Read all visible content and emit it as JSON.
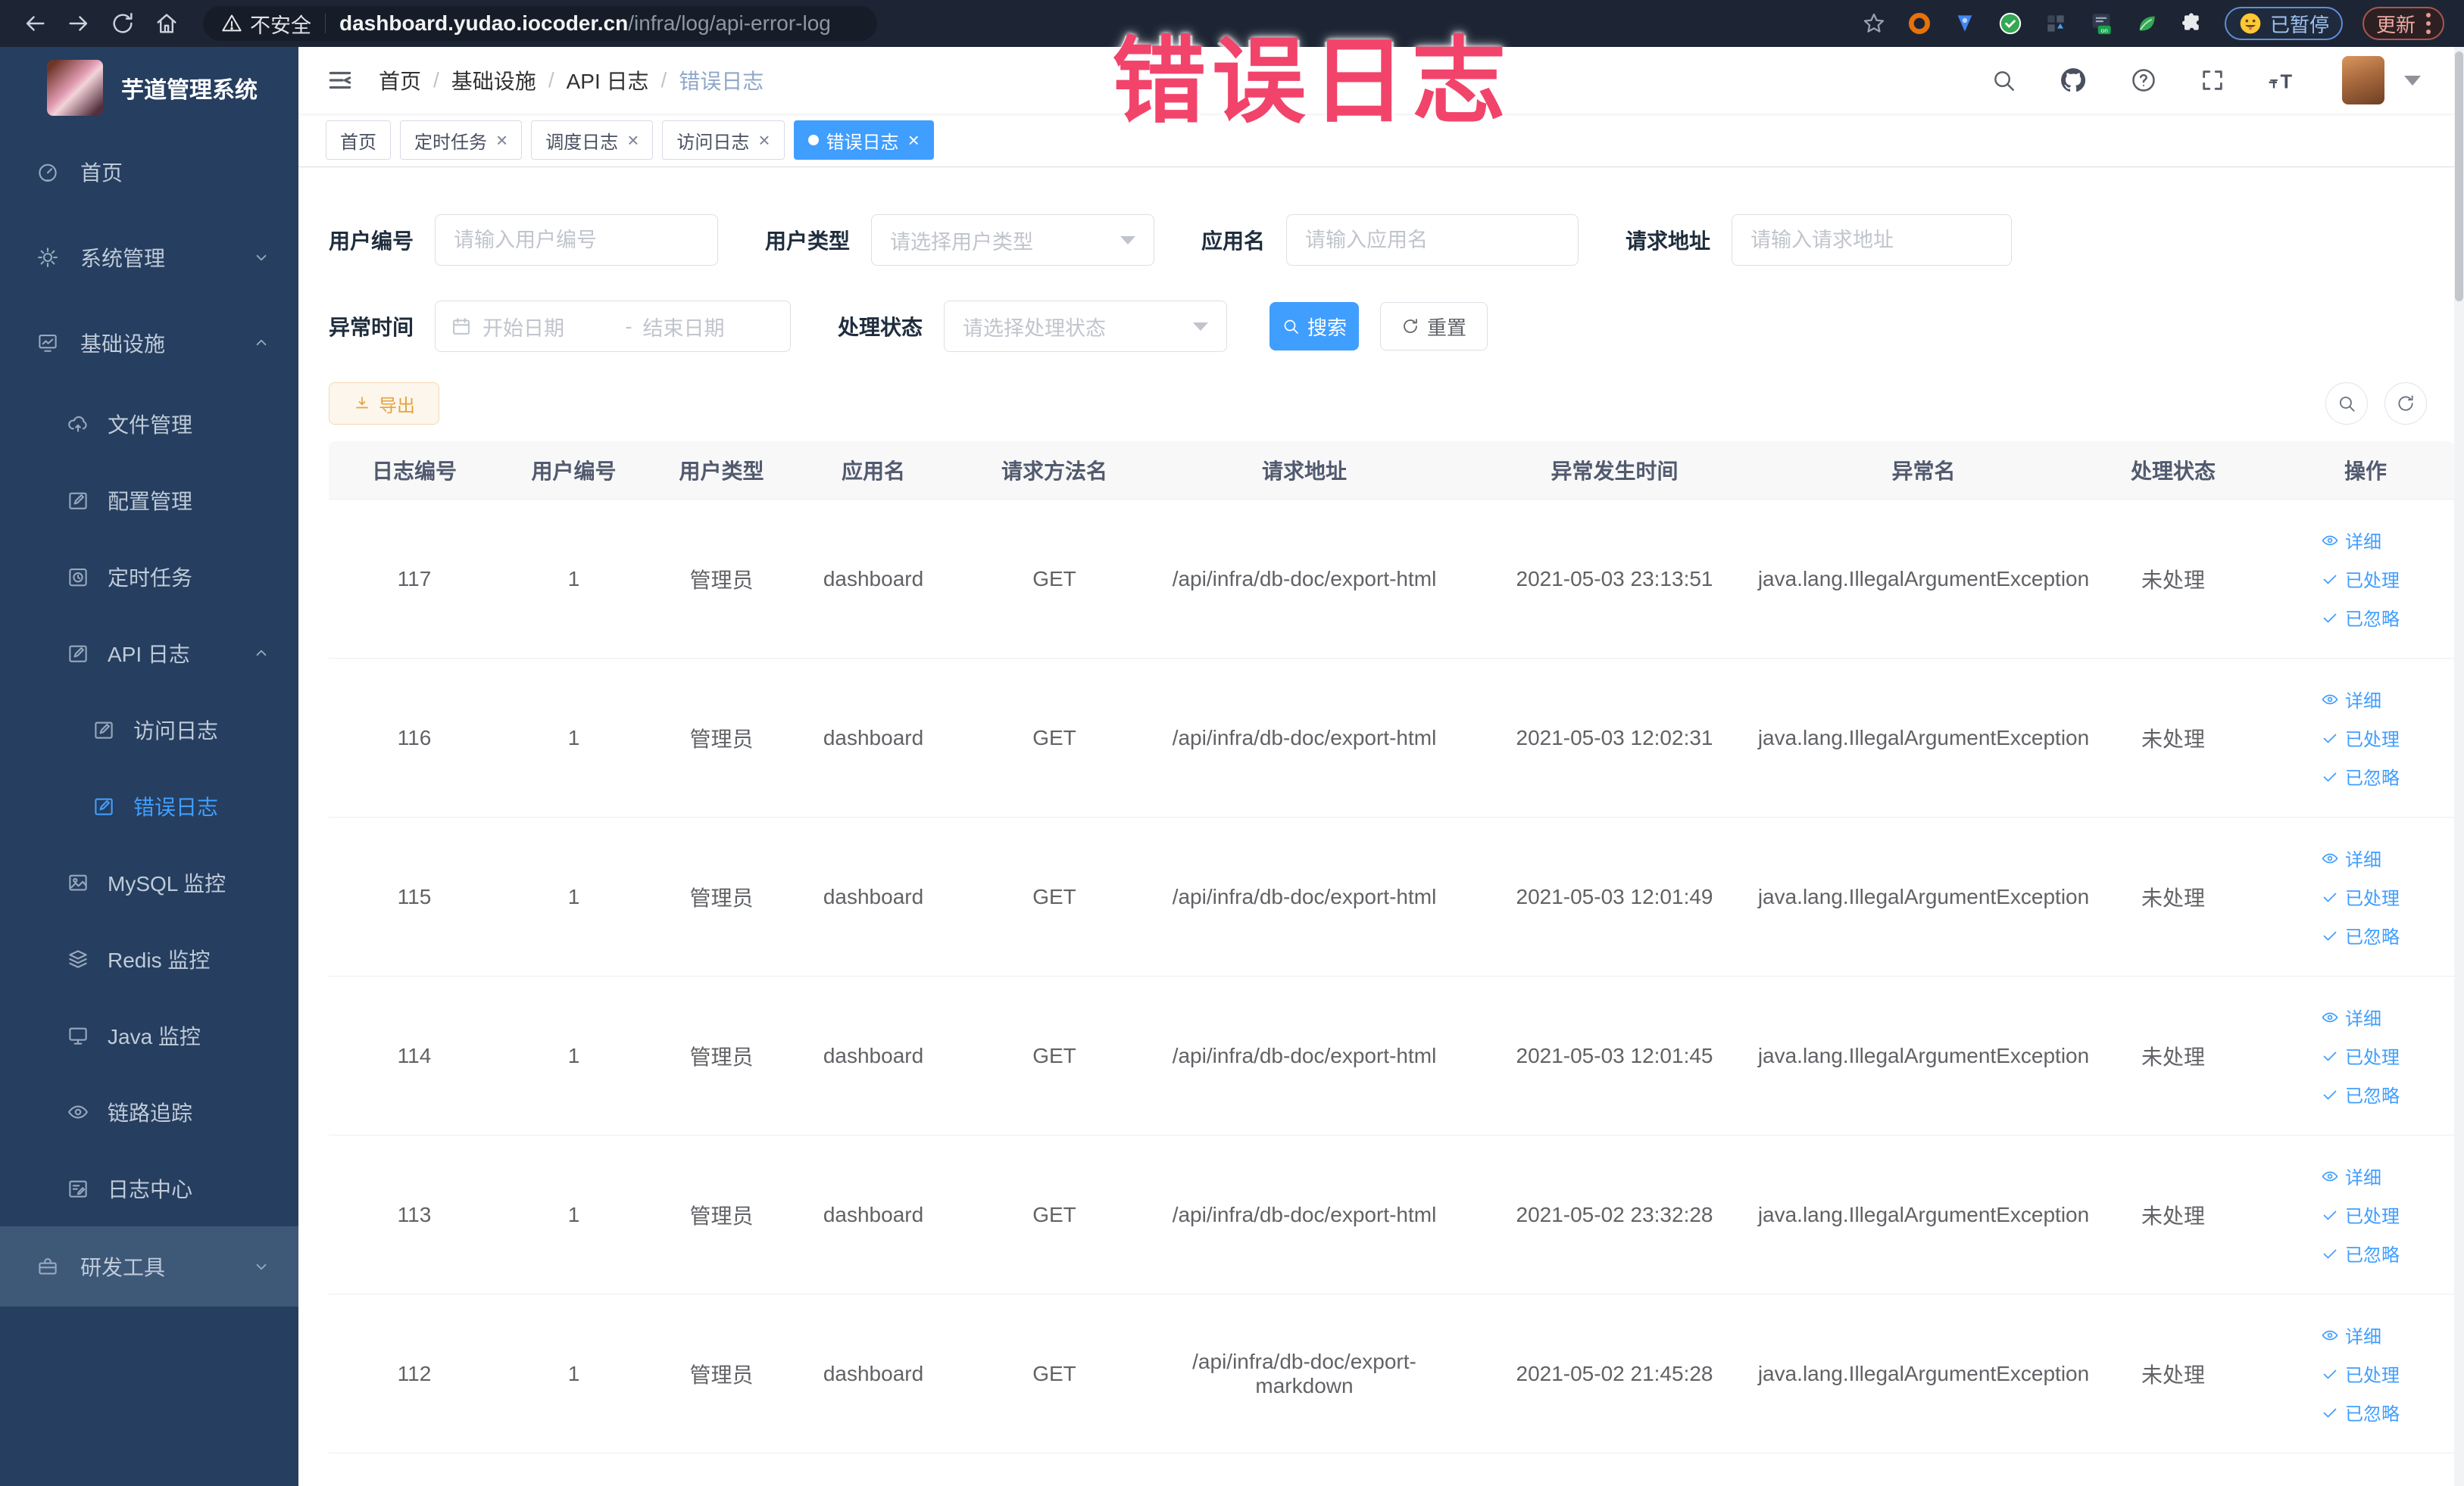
{
  "theme": {
    "accent": "#409eff",
    "sidebar_bg": "#263e5f",
    "browser_bg": "#1d2534",
    "annotation_color": "#f2436b",
    "export_warning": "#e6a23c",
    "table_header_bg": "#f8f8f9"
  },
  "annotation": {
    "text": "错误日志"
  },
  "browser": {
    "security_label": "不安全",
    "url_host": "dashboard.yudao.iocoder.cn",
    "url_path": "/infra/log/api-error-log",
    "paused_label": "已暂停",
    "update_label": "更新"
  },
  "sidebar": {
    "brand": "芋道管理系统",
    "items": [
      {
        "label": "首页"
      },
      {
        "label": "系统管理"
      },
      {
        "label": "基础设施"
      },
      {
        "label": "文件管理"
      },
      {
        "label": "配置管理"
      },
      {
        "label": "定时任务"
      },
      {
        "label": "API 日志"
      },
      {
        "label": "访问日志"
      },
      {
        "label": "错误日志"
      },
      {
        "label": "MySQL 监控"
      },
      {
        "label": "Redis 监控"
      },
      {
        "label": "Java 监控"
      },
      {
        "label": "链路追踪"
      },
      {
        "label": "日志中心"
      },
      {
        "label": "研发工具"
      }
    ]
  },
  "header": {
    "breadcrumb": [
      {
        "label": "首页"
      },
      {
        "label": "基础设施"
      },
      {
        "label": "API 日志"
      },
      {
        "label": "错误日志"
      }
    ],
    "separator": "/"
  },
  "tabs": [
    {
      "label": "首页"
    },
    {
      "label": "定时任务"
    },
    {
      "label": "调度日志"
    },
    {
      "label": "访问日志"
    },
    {
      "label": "错误日志"
    }
  ],
  "filters": {
    "user_id": {
      "label": "用户编号",
      "placeholder": "请输入用户编号"
    },
    "user_type": {
      "label": "用户类型",
      "placeholder": "请选择用户类型"
    },
    "app_name": {
      "label": "应用名",
      "placeholder": "请输入应用名"
    },
    "request_url": {
      "label": "请求地址",
      "placeholder": "请输入请求地址"
    },
    "exception_time": {
      "label": "异常时间",
      "start_placeholder": "开始日期",
      "separator": "-",
      "end_placeholder": "结束日期"
    },
    "process_status": {
      "label": "处理状态",
      "placeholder": "请选择处理状态"
    },
    "search_label": "搜索",
    "reset_label": "重置"
  },
  "toolbar": {
    "export_label": "导出"
  },
  "table": {
    "columns": [
      {
        "label": "日志编号"
      },
      {
        "label": "用户编号"
      },
      {
        "label": "用户类型"
      },
      {
        "label": "应用名"
      },
      {
        "label": "请求方法名"
      },
      {
        "label": "请求地址"
      },
      {
        "label": "异常发生时间"
      },
      {
        "label": "异常名"
      },
      {
        "label": "处理状态"
      },
      {
        "label": "操作"
      }
    ],
    "actions": {
      "detail": "详细",
      "processed": "已处理",
      "ignored": "已忽略"
    },
    "rows": [
      {
        "id": "117",
        "user_id": "1",
        "user_type": "管理员",
        "app": "dashboard",
        "method": "GET",
        "url": "/api/infra/db-doc/export-html",
        "time": "2021-05-03 23:13:51",
        "exception": "java.lang.IllegalArgumentException",
        "status": "未处理"
      },
      {
        "id": "116",
        "user_id": "1",
        "user_type": "管理员",
        "app": "dashboard",
        "method": "GET",
        "url": "/api/infra/db-doc/export-html",
        "time": "2021-05-03 12:02:31",
        "exception": "java.lang.IllegalArgumentException",
        "status": "未处理"
      },
      {
        "id": "115",
        "user_id": "1",
        "user_type": "管理员",
        "app": "dashboard",
        "method": "GET",
        "url": "/api/infra/db-doc/export-html",
        "time": "2021-05-03 12:01:49",
        "exception": "java.lang.IllegalArgumentException",
        "status": "未处理"
      },
      {
        "id": "114",
        "user_id": "1",
        "user_type": "管理员",
        "app": "dashboard",
        "method": "GET",
        "url": "/api/infra/db-doc/export-html",
        "time": "2021-05-03 12:01:45",
        "exception": "java.lang.IllegalArgumentException",
        "status": "未处理"
      },
      {
        "id": "113",
        "user_id": "1",
        "user_type": "管理员",
        "app": "dashboard",
        "method": "GET",
        "url": "/api/infra/db-doc/export-html",
        "time": "2021-05-02 23:32:28",
        "exception": "java.lang.IllegalArgumentException",
        "status": "未处理"
      },
      {
        "id": "112",
        "user_id": "1",
        "user_type": "管理员",
        "app": "dashboard",
        "method": "GET",
        "url": "/api/infra/db-doc/export-markdown",
        "time": "2021-05-02 21:45:28",
        "exception": "java.lang.IllegalArgumentException",
        "status": "未处理"
      }
    ]
  }
}
